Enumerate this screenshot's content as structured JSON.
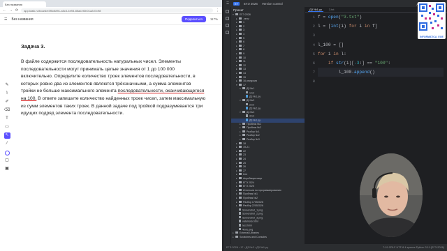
{
  "browser": {
    "tab_title": "Без названия",
    "url": "app.ktalk.ru/board/e3f5c8891-a5c3-4e93-85ad-93b01a2d7c98",
    "board_title": "Без названия",
    "share_label": "Поделиться",
    "zoom_label": "117%"
  },
  "task": {
    "title": "Задача 3.",
    "before_underline": "В файле содержится последовательность натуральных чисел. Элементы последовательности могут принимать целые значения от 1 до 100 000 включительно. Определите количество троек элементов последовательности, в которых ровно два из элементов являются трёхзначными, а сумма элементов тройки не больше максимального элемента ",
    "underlined": "последовательности, оканчивающегося на 100.",
    "after_underline": " В ответе запишите количество найденных троек чисел, затем максимальную из сумм элементов таких троек. В данной задаче под тройкой подразумевается три идущих подряд элемента последовательности."
  },
  "ide": {
    "project_badge": "ЕГ",
    "project_name": "ЕГЭ 2026",
    "branch": "Version control",
    "current_file": "Д3 №1.py",
    "tabs": [
      "Д3 №1.py",
      "3.txt"
    ],
    "tree_header": "Проект",
    "tree": [
      {
        "label": "ЕГЭ 2026",
        "type": "folder",
        "indent": 0,
        "open": true
      },
      {
        "label": ".venv",
        "type": "folder",
        "indent": 1
      },
      {
        "label": "1",
        "type": "folder",
        "indent": 1
      },
      {
        "label": "2",
        "type": "folder",
        "indent": 1
      },
      {
        "label": "3",
        "type": "folder",
        "indent": 1
      },
      {
        "label": "4",
        "type": "folder",
        "indent": 1
      },
      {
        "label": "5",
        "type": "folder",
        "indent": 1
      },
      {
        "label": "6",
        "type": "folder",
        "indent": 1
      },
      {
        "label": "7",
        "type": "folder",
        "indent": 1
      },
      {
        "label": "8",
        "type": "folder",
        "indent": 1
      },
      {
        "label": "9",
        "type": "folder",
        "indent": 1
      },
      {
        "label": "10",
        "type": "folder",
        "indent": 1
      },
      {
        "label": "11",
        "type": "folder",
        "indent": 1
      },
      {
        "label": "12",
        "type": "folder",
        "indent": 1
      },
      {
        "label": "13",
        "type": "folder",
        "indent": 1
      },
      {
        "label": "14",
        "type": "folder",
        "indent": 1
      },
      {
        "label": "15",
        "type": "folder",
        "indent": 1
      },
      {
        "label": "16 рекурсия",
        "type": "folder",
        "indent": 1
      },
      {
        "label": "17",
        "type": "folder",
        "indent": 1,
        "open": true
      },
      {
        "label": "Д3 №1",
        "type": "folder",
        "indent": 2,
        "open": true
      },
      {
        "label": "1.txt",
        "type": "file",
        "indent": 3
      },
      {
        "label": "Д3 №1.py",
        "type": "py",
        "indent": 3
      },
      {
        "label": "Д3 №2",
        "type": "folder",
        "indent": 2,
        "open": true
      },
      {
        "label": "2.txt",
        "type": "file",
        "indent": 3
      },
      {
        "label": "Д3 №2.py",
        "type": "py",
        "indent": 3
      },
      {
        "label": "Д3 №3",
        "type": "folder",
        "indent": 2,
        "open": true
      },
      {
        "label": "3.txt",
        "type": "file",
        "indent": 3
      },
      {
        "label": "Д3 №1.py",
        "type": "py",
        "indent": 3,
        "selected": true
      },
      {
        "label": "Пробник №1",
        "type": "folder",
        "indent": 2
      },
      {
        "label": "Пробник №2",
        "type": "folder",
        "indent": 2
      },
      {
        "label": "Разбор №1",
        "type": "folder",
        "indent": 2
      },
      {
        "label": "Разбор №2",
        "type": "folder",
        "indent": 2
      },
      {
        "label": "Разбор №3",
        "type": "folder",
        "indent": 2
      },
      {
        "label": "18",
        "type": "folder",
        "indent": 1
      },
      {
        "label": "19-21",
        "type": "folder",
        "indent": 1
      },
      {
        "label": "22",
        "type": "folder",
        "indent": 1
      },
      {
        "label": "23",
        "type": "folder",
        "indent": 1
      },
      {
        "label": "24",
        "type": "folder",
        "indent": 1
      },
      {
        "label": "25",
        "type": "folder",
        "indent": 1
      },
      {
        "label": "26",
        "type": "folder",
        "indent": 1
      },
      {
        "label": "27",
        "type": "folder",
        "indent": 1
      },
      {
        "label": "test",
        "type": "folder",
        "indent": 1
      },
      {
        "label": "Апробация март",
        "type": "folder",
        "indent": 1
      },
      {
        "label": "ЕГЭ 2024",
        "type": "folder",
        "indent": 1
      },
      {
        "label": "ЕГЭ 2025",
        "type": "folder",
        "indent": 1
      },
      {
        "label": "Интенсив по программированию",
        "type": "folder",
        "indent": 1
      },
      {
        "label": "Пробник №1",
        "type": "folder",
        "indent": 1
      },
      {
        "label": "Пробник №2",
        "type": "folder",
        "indent": 1
      },
      {
        "label": "Разбор 17052026",
        "type": "folder",
        "indent": 1
      },
      {
        "label": "Разбор 22052026",
        "type": "folder",
        "indent": 1
      },
      {
        "label": "Screenshot_1.png",
        "type": "file",
        "indent": 1
      },
      {
        "label": "Screenshot_2.png",
        "type": "file",
        "indent": 1
      },
      {
        "label": "Screenshot_3.png",
        "type": "file",
        "indent": 1
      },
      {
        "label": "vatemoto.html",
        "type": "file",
        "indent": 1
      },
      {
        "label": "test.html",
        "type": "file",
        "indent": 1
      },
      {
        "label": "Фото.png",
        "type": "file",
        "indent": 1
      },
      {
        "label": "External Libraries",
        "type": "folder",
        "indent": 0
      },
      {
        "label": "Scratches and Consoles",
        "type": "folder",
        "indent": 0
      }
    ],
    "code": [
      [
        {
          "t": "f",
          "c": ""
        },
        {
          "t": " = ",
          "c": ""
        },
        {
          "t": "open",
          "c": "fn"
        },
        {
          "t": "(",
          "c": ""
        },
        {
          "t": "\"3.txt\"",
          "c": "st"
        },
        {
          "t": ")",
          "c": ""
        }
      ],
      [
        {
          "t": "l = [",
          "c": ""
        },
        {
          "t": "int",
          "c": "fn"
        },
        {
          "t": "(i) ",
          "c": ""
        },
        {
          "t": "for",
          "c": "kw"
        },
        {
          "t": " i ",
          "c": ""
        },
        {
          "t": "in",
          "c": "kw"
        },
        {
          "t": " f]",
          "c": ""
        }
      ],
      [],
      [
        {
          "t": "l_100 = []",
          "c": ""
        }
      ],
      [
        {
          "t": "for",
          "c": "kw"
        },
        {
          "t": " i ",
          "c": ""
        },
        {
          "t": "in",
          "c": "kw"
        },
        {
          "t": " l:",
          "c": ""
        }
      ],
      [
        {
          "t": "    ",
          "c": ""
        },
        {
          "t": "if",
          "c": "kw"
        },
        {
          "t": " ",
          "c": ""
        },
        {
          "t": "str",
          "c": "fn"
        },
        {
          "t": "(i)[",
          "c": ""
        },
        {
          "t": "-3",
          "c": "nm"
        },
        {
          "t": ":] == ",
          "c": ""
        },
        {
          "t": "\"100\"",
          "c": "st"
        },
        {
          "t": ":",
          "c": ""
        }
      ],
      [
        {
          "t": "        l_100.",
          "c": ""
        },
        {
          "t": "append",
          "c": "fn"
        },
        {
          "t": "()",
          "c": ""
        }
      ],
      []
    ],
    "line_numbers": [
      "1",
      "2",
      "3",
      "4",
      "5",
      "6",
      "7",
      "8"
    ],
    "status_left": "ЕГЭ 2026 › 17 › Д3 №3 › Д3 №1.py",
    "status_right": "7:19  CRLF  UTF-8  4 spaces  Python 3.11 (ЕГЭ 2026)"
  },
  "overlay": {
    "qr_caption": "INFORMATICA_EGE"
  }
}
